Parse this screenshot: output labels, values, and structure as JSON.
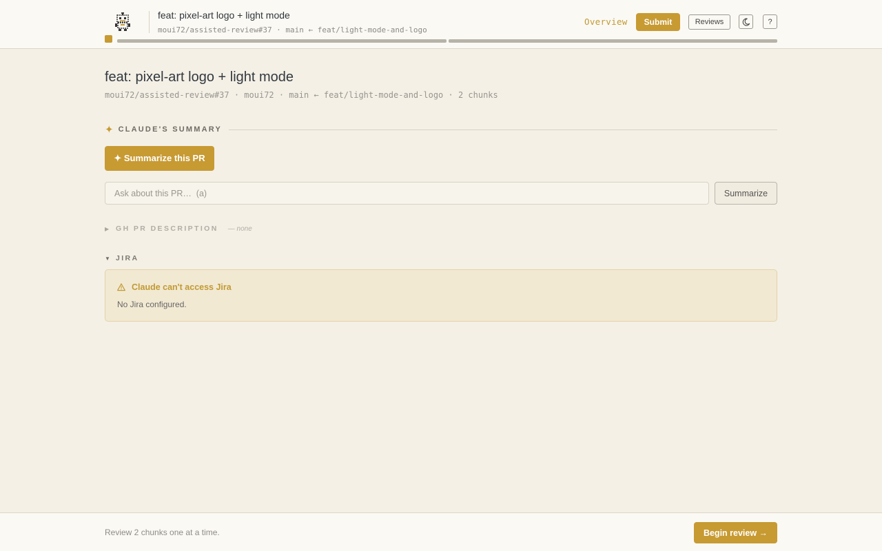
{
  "header": {
    "title": "feat: pixel-art logo + light mode",
    "subtitle": "moui72/assisted-review#37 · main ← feat/light-mode-and-logo",
    "nav_overview": "Overview",
    "submit_label": "Submit",
    "reviews_label": "Reviews",
    "theme_icon": "moon-icon",
    "help_label": "?",
    "progress_segments": 2
  },
  "pr": {
    "title": "feat: pixel-art logo + light mode",
    "meta": "moui72/assisted-review#37 · moui72 · main ← feat/light-mode-and-logo · 2 chunks"
  },
  "summary": {
    "section_label": "CLAUDE'S SUMMARY",
    "summarize_pr_label": "✦ Summarize this PR",
    "ask_placeholder": "Ask about this PR…  (a)",
    "summarize_label": "Summarize"
  },
  "gh_description": {
    "label": "GH PR DESCRIPTION",
    "value": "— none"
  },
  "jira": {
    "label": "JIRA",
    "warning": "Claude can't access Jira",
    "message": "No Jira configured."
  },
  "footer": {
    "text": "Review 2 chunks one at a time.",
    "begin_label": "Begin review →"
  },
  "colors": {
    "accent": "#c79a32",
    "background": "#f4f0e6",
    "warning_bg": "#f2e9d3"
  }
}
